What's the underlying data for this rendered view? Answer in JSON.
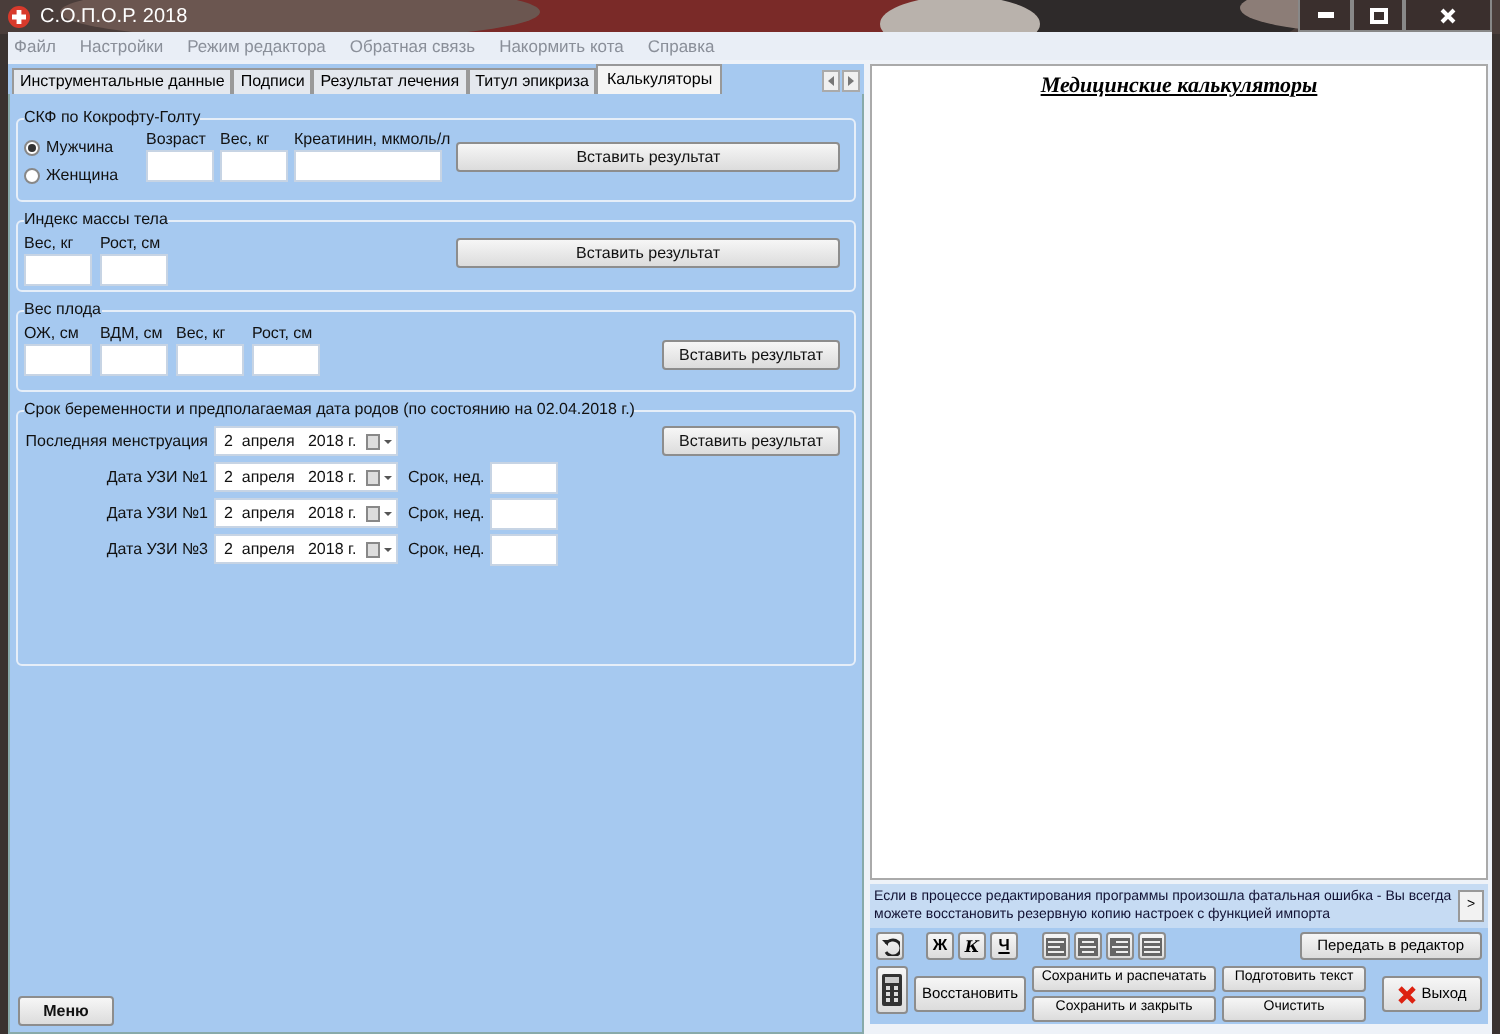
{
  "window": {
    "title": "С.О.П.О.Р. 2018"
  },
  "menu": [
    "Файл",
    "Настройки",
    "Режим редактора",
    "Обратная связь",
    "Накормить кота",
    "Справка"
  ],
  "tabs": [
    {
      "label": "Инструментальные данные",
      "selected": false
    },
    {
      "label": "Подписи",
      "selected": false
    },
    {
      "label": "Результат лечения",
      "selected": false
    },
    {
      "label": "Титул эпикриза",
      "selected": false
    },
    {
      "label": "Калькуляторы",
      "selected": true
    }
  ],
  "gfr": {
    "title": "СКФ по Кокрофту-Голту",
    "sex_options": [
      {
        "label": "Мужчина",
        "selected": true
      },
      {
        "label": "Женщина",
        "selected": false
      }
    ],
    "fields": [
      "Возраст",
      "Вес, кг",
      "Креатинин, мкмоль/л"
    ],
    "button": "Вставить результат"
  },
  "bmi": {
    "title": "Индекс массы тела",
    "fields": [
      "Вес, кг",
      "Рост, см"
    ],
    "button": "Вставить результат"
  },
  "fetal_weight": {
    "title": "Вес плода",
    "fields": [
      "ОЖ, см",
      "ВДМ, см",
      "Вес, кг",
      "Рост, см"
    ],
    "button": "Вставить результат"
  },
  "pregnancy": {
    "title": "Срок беременности и предполагаемая дата родов (по состоянию на 02.04.2018 г.)",
    "button": "Вставить результат",
    "rows": [
      {
        "label": "Последняя менструация",
        "date": "2  апреля   2018 г."
      },
      {
        "label": "Дата УЗИ №1",
        "date": "2  апреля   2018 г.",
        "term_label": "Срок, нед."
      },
      {
        "label": "Дата УЗИ №1",
        "date": "2  апреля   2018 г.",
        "term_label": "Срок, нед."
      },
      {
        "label": "Дата УЗИ №3",
        "date": "2  апреля   2018 г.",
        "term_label": "Срок, нед."
      }
    ]
  },
  "menu_button": "Меню",
  "editor": {
    "title": "Медицинские калькуляторы"
  },
  "notice": {
    "text": "Если в процессе редактирования программы произошла фатальная ошибка - Вы всегда можете восстановить резервную копию настроек с функцией импорта",
    "button": ">"
  },
  "format_buttons": [
    "Ж",
    "К",
    "Ч"
  ],
  "buttons": {
    "send": "Передать в редактор",
    "restore": "Восстановить",
    "save_print": "Сохранить и распечатать",
    "save_close": "Сохранить и закрыть",
    "prepare": "Подготовить текст",
    "clear": "Очистить",
    "exit": "Выход"
  }
}
